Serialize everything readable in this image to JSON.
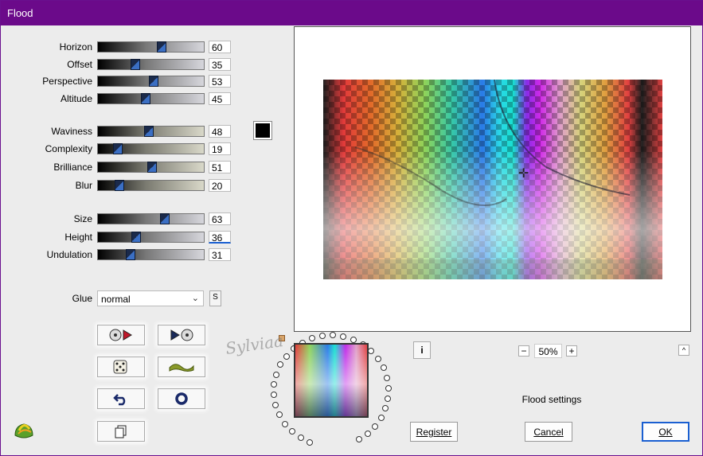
{
  "window": {
    "title": "Flood"
  },
  "sliders": [
    {
      "label": "Horizon",
      "value": "60",
      "level": 60,
      "track": "gray"
    },
    {
      "label": "Offset",
      "value": "35",
      "level": 35,
      "track": "gray"
    },
    {
      "label": "Perspective",
      "value": "53",
      "level": 53,
      "track": "gray"
    },
    {
      "label": "Altitude",
      "value": "45",
      "level": 45,
      "track": "gray"
    },
    {
      "label": "Waviness",
      "value": "48",
      "level": 48,
      "track": "tan"
    },
    {
      "label": "Complexity",
      "value": "19",
      "level": 19,
      "track": "tan"
    },
    {
      "label": "Brilliance",
      "value": "51",
      "level": 51,
      "track": "tan"
    },
    {
      "label": "Blur",
      "value": "20",
      "level": 20,
      "track": "tan"
    },
    {
      "label": "Size",
      "value": "63",
      "level": 63,
      "track": "gray"
    },
    {
      "label": "Height",
      "value": "36",
      "level": 36,
      "track": "gray"
    },
    {
      "label": "Undulation",
      "value": "31",
      "level": 31,
      "track": "gray"
    }
  ],
  "color": {
    "swatch": "#000000"
  },
  "glue": {
    "label": "Glue",
    "value": "normal",
    "s_label": "S"
  },
  "tools": {
    "cd_play_left": "cd-play-left-icon",
    "cd_play_right": "cd-play-right-icon",
    "dice": "dice-icon",
    "wave": "wave-icon",
    "undo": "undo-icon",
    "ring": "ring-icon",
    "copy": "copy-icon"
  },
  "zoom": {
    "value": "50%",
    "minus": "−",
    "plus": "+"
  },
  "info": {
    "label": "i"
  },
  "collapse": {
    "label": "^"
  },
  "settings_label": "Flood settings",
  "buttons": {
    "register": "Register",
    "cancel": "Cancel",
    "ok": "OK"
  },
  "watermark": {
    "text": "Sylviaa"
  },
  "accent": "#6b0a8a"
}
